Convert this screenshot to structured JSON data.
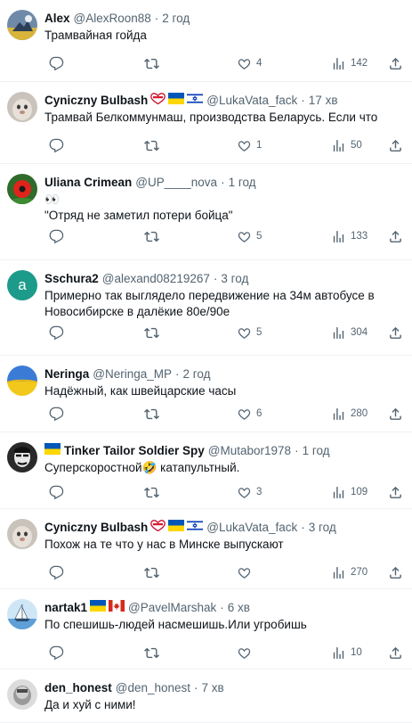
{
  "tweets": [
    {
      "name": "Alex",
      "handle": "@AlexRoon88",
      "time": "2 год",
      "lines": [
        "Трамвайная гойда"
      ],
      "likes": "4",
      "views": "142",
      "flags": []
    },
    {
      "name": "Cyniczny Bulbash",
      "handle": "@LukaVata_fack",
      "time": "17 хв",
      "lines": [
        "Трамвай Белкоммунмаш, производства Беларусь. Если что"
      ],
      "likes": "1",
      "views": "50",
      "flags": [
        "heart",
        "ua",
        "il"
      ]
    },
    {
      "name": "Uliana Crimean",
      "handle": "@UP____nova",
      "time": "1 год",
      "lines": [
        "👀",
        "\"Отряд не заметил потери бойца\""
      ],
      "likes": "5",
      "views": "133",
      "flags": []
    },
    {
      "name": "Sschura2",
      "handle": "@alexand08219267",
      "time": "3 год",
      "lines": [
        "Примерно так выглядело передвижение на 34м автобусе в",
        "Новосибирске в далёкие 80е/90е"
      ],
      "likes": "5",
      "views": "304",
      "flags": [],
      "avatar_letter": "a"
    },
    {
      "name": "Neringa",
      "handle": "@Neringa_MP",
      "time": "2 год",
      "lines": [
        "Надёжный, как швейцарские часы"
      ],
      "likes": "6",
      "views": "280",
      "flags": []
    },
    {
      "name": "Tinker Tailor Soldier Spy",
      "handle": "@Mutabor1978",
      "time": "1 год",
      "lines": [
        "Суперскоростной🤣 катапультный."
      ],
      "likes": "3",
      "views": "109",
      "flags": [
        "ua-lead"
      ]
    },
    {
      "name": "Cyniczny Bulbash",
      "handle": "@LukaVata_fack",
      "time": "3 год",
      "lines": [
        "Похож на те что у нас в Минске выпускают"
      ],
      "likes": "",
      "views": "270",
      "flags": [
        "heart",
        "ua",
        "il"
      ]
    },
    {
      "name": "nartak1",
      "handle": "@PavelMarshak",
      "time": "6 хв",
      "lines": [
        "По спешишь-людей насмешишь.Или угробишь"
      ],
      "likes": "",
      "views": "10",
      "flags": [
        "ua",
        "ca"
      ]
    },
    {
      "name": "den_honest",
      "handle": "@den_honest",
      "time": "7 хв",
      "lines": [
        "Да и хуй с ними!"
      ],
      "likes": "",
      "views": "",
      "flags": []
    }
  ],
  "icons": {
    "reply": "reply-icon",
    "retweet": "retweet-icon",
    "like": "like-icon",
    "views": "views-icon",
    "share": "share-icon"
  },
  "colors": {
    "text": "#0f1419",
    "secondary": "#536471",
    "divider": "#eff3f4",
    "sschura_avatar": "#1d9b8a"
  }
}
